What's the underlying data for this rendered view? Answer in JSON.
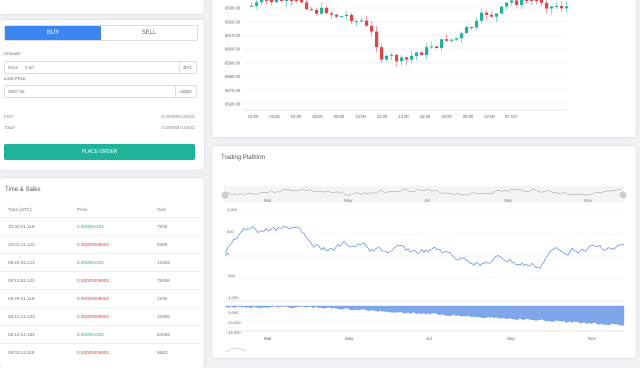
{
  "order": {
    "tabs": {
      "buy": "BUY",
      "sell": "SELL"
    },
    "amount_label": "Amount",
    "amount_max": "MAX",
    "amount_value": "0.00",
    "amount_unit": "BTC",
    "limit_label": "Limit Price",
    "limit_value": "3007.55",
    "limit_unit": "USDC",
    "fee_label": "Fee*",
    "fee_value": "0.000000 USDC",
    "total_label": "Total*",
    "total_value": "0.000000 USDC",
    "place_button": "PLACE ORDER"
  },
  "time_sales": {
    "title": "Time & Sales",
    "columns": [
      "Time (UTC)",
      "Price",
      "Size"
    ],
    "rows": [
      {
        "time": "10:30:41.119",
        "price": "0.000001234",
        "size": "7845",
        "side": "buy"
      },
      {
        "time": "10:01:11.121",
        "price": "0.00000009853",
        "size": "8459",
        "side": "sell"
      },
      {
        "time": "09:24:42.212",
        "price": "0.000001234",
        "size": "12459",
        "side": "buy"
      },
      {
        "time": "09:13:52.120",
        "price": "0.00000009853",
        "size": "75456",
        "side": "sell"
      },
      {
        "time": "08:26:41.119",
        "price": "0.00000009853",
        "size": "1235",
        "side": "sell"
      },
      {
        "time": "08:12:12.123",
        "price": "0.00000009853",
        "size": "12596",
        "side": "sell"
      },
      {
        "time": "08:10:12.150",
        "price": "0.000001234",
        "size": "54269",
        "side": "buy"
      },
      {
        "time": "08:03:12.119",
        "price": "0.00000009853",
        "size": "8663",
        "side": "sell"
      }
    ]
  },
  "candles_chart": {
    "y_ticks": [
      "6630.00",
      "6620.00",
      "6610.00",
      "6600.00",
      "6590.00",
      "6580.00",
      "6570.00",
      "6560.00"
    ],
    "x_ticks": [
      "23:00",
      "02:00",
      "04:00",
      "06:00",
      "08:00",
      "10:00",
      "12:00",
      "14:00",
      "16:00",
      "18:00",
      "20:00",
      "22:00",
      "07 Oct"
    ]
  },
  "trading": {
    "title": "Trading Platform",
    "nav_ticks": [
      "Mar",
      "May",
      "Jul",
      "Sep",
      "Nov"
    ],
    "main_y_ticks": [
      "1,000",
      "500",
      "0",
      "-500",
      "-1,000"
    ],
    "vol_y_ticks": [
      "-5,000",
      "-10,000",
      "-15,000"
    ],
    "x_ticks": [
      "Mar",
      "May",
      "Jul",
      "Sep",
      "Nov"
    ]
  },
  "colors": {
    "buy": "#1fb39b",
    "sell": "#e0434a",
    "accent": "#3d86f0",
    "line": "#5b8de0"
  }
}
